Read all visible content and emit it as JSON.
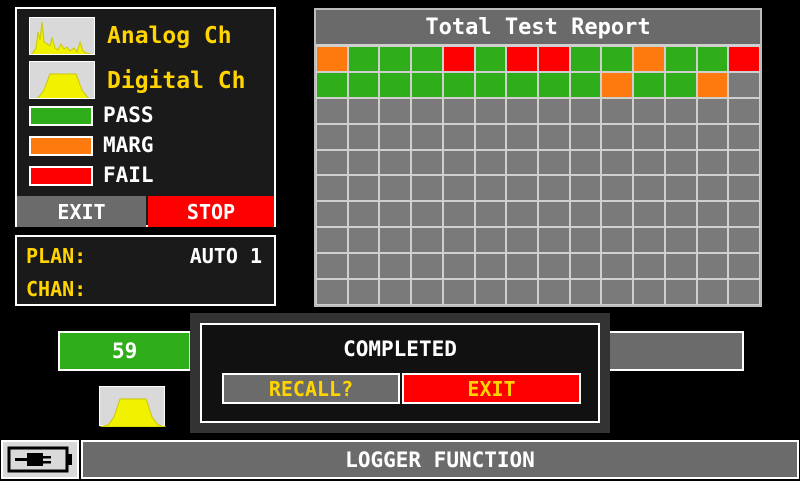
{
  "legend": {
    "analog_label": "Analog Ch",
    "digital_label": "Digital Ch",
    "pass_label": "PASS",
    "marg_label": "MARG",
    "fail_label": "FAIL",
    "exit_label": "EXIT",
    "stop_label": "STOP",
    "colors": {
      "pass": "#2fae1a",
      "marg": "#ff7a0e",
      "fail": "#ff0000",
      "accent_text": "#ffd400"
    }
  },
  "plan": {
    "plan_label": "PLAN:",
    "plan_value": "AUTO 1",
    "chan_label": "CHAN:",
    "chan_value": ""
  },
  "report": {
    "title": "Total Test Report",
    "columns": 14,
    "rows": [
      [
        "MARG",
        "PASS",
        "PASS",
        "PASS",
        "FAIL",
        "PASS",
        "FAIL",
        "FAIL",
        "PASS",
        "PASS",
        "MARG",
        "PASS",
        "PASS",
        "FAIL"
      ],
      [
        "PASS",
        "PASS",
        "PASS",
        "PASS",
        "PASS",
        "PASS",
        "PASS",
        "PASS",
        "PASS",
        "MARG",
        "PASS",
        "PASS",
        "MARG",
        ""
      ],
      [
        "",
        "",
        "",
        "",
        "",
        "",
        "",
        "",
        "",
        "",
        "",
        "",
        "",
        ""
      ],
      [
        "",
        "",
        "",
        "",
        "",
        "",
        "",
        "",
        "",
        "",
        "",
        "",
        "",
        ""
      ],
      [
        "",
        "",
        "",
        "",
        "",
        "",
        "",
        "",
        "",
        "",
        "",
        "",
        "",
        ""
      ],
      [
        "",
        "",
        "",
        "",
        "",
        "",
        "",
        "",
        "",
        "",
        "",
        "",
        "",
        ""
      ],
      [
        "",
        "",
        "",
        "",
        "",
        "",
        "",
        "",
        "",
        "",
        "",
        "",
        "",
        ""
      ],
      [
        "",
        "",
        "",
        "",
        "",
        "",
        "",
        "",
        "",
        "",
        "",
        "",
        "",
        ""
      ],
      [
        "",
        "",
        "",
        "",
        "",
        "",
        "",
        "",
        "",
        "",
        "",
        "",
        "",
        ""
      ],
      [
        "",
        "",
        "",
        "",
        "",
        "",
        "",
        "",
        "",
        "",
        "",
        "",
        "",
        ""
      ]
    ]
  },
  "progress": {
    "value_label": "59",
    "fraction": 0.194
  },
  "dialog": {
    "title": "COMPLETED",
    "recall_label": "RECALL?",
    "exit_label": "EXIT"
  },
  "status_bar": {
    "title": "LOGGER FUNCTION",
    "battery_icon": "battery-plug-icon"
  }
}
